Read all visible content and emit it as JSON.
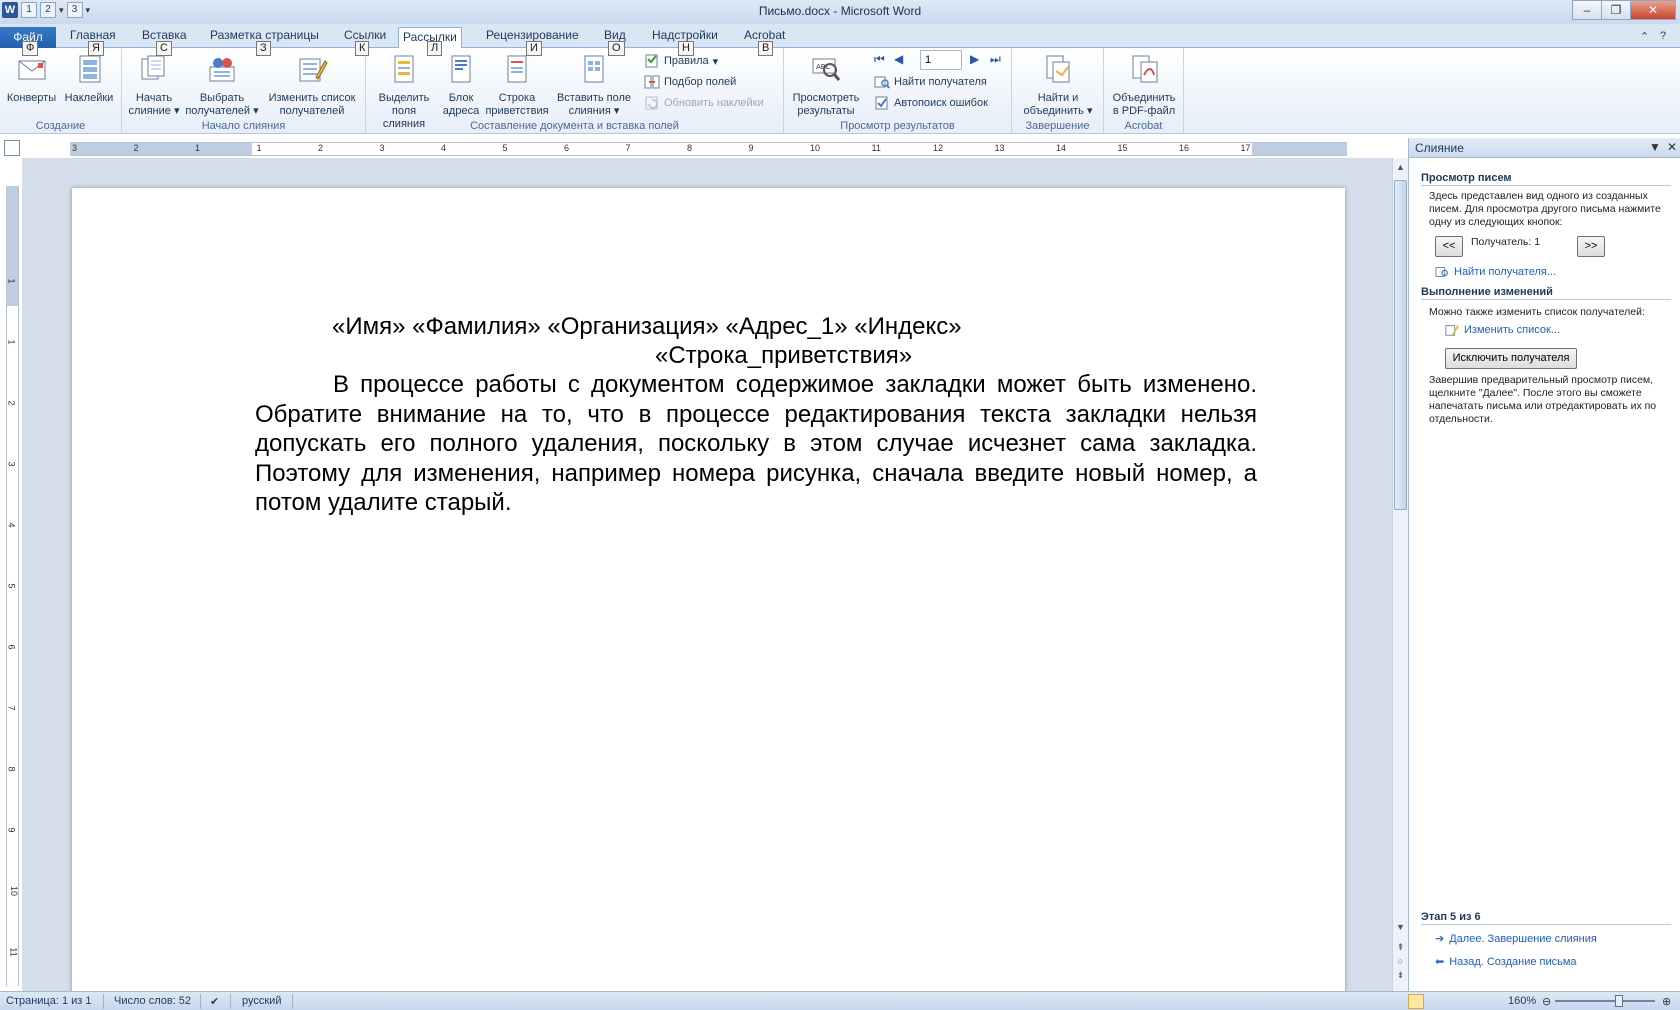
{
  "window": {
    "title": "Письмо.docx - Microsoft Word",
    "controls": [
      "–",
      "❐",
      "✕"
    ]
  },
  "qat": {
    "keytips": [
      "1",
      "2",
      "3"
    ]
  },
  "tabs": [
    {
      "label": "Файл",
      "keytip": "Ф"
    },
    {
      "label": "Главная",
      "keytip": "Я"
    },
    {
      "label": "Вставка",
      "keytip": "С"
    },
    {
      "label": "Разметка страницы",
      "keytip": "З"
    },
    {
      "label": "Ссылки",
      "keytip": "К"
    },
    {
      "label": "Рассылки",
      "keytip": "Л",
      "active": true
    },
    {
      "label": "Рецензирование",
      "keytip": "И"
    },
    {
      "label": "Вид",
      "keytip": "О"
    },
    {
      "label": "Надстройки",
      "keytip": "Н"
    },
    {
      "label": "Acrobat",
      "keytip": "В"
    }
  ],
  "ribbon": {
    "groups": {
      "create": "Создание",
      "start_merge": "Начало слияния",
      "write_insert": "Составление документа и вставка полей",
      "preview": "Просмотр результатов",
      "finish": "Завершение",
      "acrobat": "Acrobat"
    },
    "buttons": {
      "envelopes": "Конверты",
      "labels": "Наклейки",
      "start_merge_1": "Начать",
      "start_merge_2": "слияние",
      "select_recipients_1": "Выбрать",
      "select_recipients_2": "получателей",
      "edit_list_1": "Изменить список",
      "edit_list_2": "получателей",
      "highlight_1": "Выделить",
      "highlight_2": "поля слияния",
      "address_block_1": "Блок",
      "address_block_2": "адреса",
      "greeting_1": "Строка",
      "greeting_2": "приветствия",
      "insert_field_1": "Вставить поле",
      "insert_field_2": "слияния",
      "rules": "Правила",
      "match_fields": "Подбор полей",
      "update_labels": "Обновить наклейки",
      "preview_1": "Просмотреть",
      "preview_2": "результаты",
      "record_number": "1",
      "find_recipient": "Найти получателя",
      "auto_check": "Автопоиск ошибок",
      "finish_1": "Найти и",
      "finish_2": "объединить",
      "pdf_1": "Объединить",
      "pdf_2": "в PDF-файл"
    }
  },
  "ruler": {
    "h_numbers": [
      "3",
      "2",
      "1",
      "1",
      "2",
      "3",
      "4",
      "5",
      "6",
      "7",
      "8",
      "9",
      "10",
      "11",
      "12",
      "13",
      "14",
      "15",
      "16",
      "17"
    ],
    "v_numbers": [
      "1",
      "1",
      "2",
      "3",
      "4",
      "5",
      "6",
      "7",
      "8",
      "9",
      "10",
      "11"
    ]
  },
  "document": {
    "line1": "«Имя» «Фамилия» «Организация» «Адрес_1» «Индекс»",
    "line2": "«Строка_приветствия»",
    "paragraph": "В процессе работы с документом содержимое закладки может быть изменено. Обратите внимание на то, что в процессе редактирования текста закладки нельзя допускать его полного удаления, поскольку в этом случае исчезнет сама закладка. Поэтому для изменения, например номера рисунка, сначала введите новый номер, а потом удалите старый."
  },
  "pane": {
    "title": "Слияние",
    "section1_title": "Просмотр писем",
    "section1_text": "Здесь представлен вид одного из созданных писем. Для просмотра другого письма нажмите одну из следующих кнопок:",
    "prev_btn": "<<",
    "recipient_label": "Получатель: 1",
    "next_btn": ">>",
    "find_link": "Найти получателя...",
    "section2_title": "Выполнение изменений",
    "section2_text": "Можно также изменить список получателей:",
    "edit_list_link": "Изменить список...",
    "exclude_btn": "Исключить получателя",
    "section2_text2": "Завершив предварительный просмотр писем, щелкните \"Далее\". После этого вы сможете напечатать письма или отредактировать их по отдельности.",
    "step_title": "Этап 5 из 6",
    "next_step": "Далее. Завершение слияния",
    "prev_step": "Назад. Создание письма"
  },
  "status": {
    "page": "Страница: 1 из 1",
    "words": "Число слов: 52",
    "language": "русский",
    "zoom": "160%"
  }
}
